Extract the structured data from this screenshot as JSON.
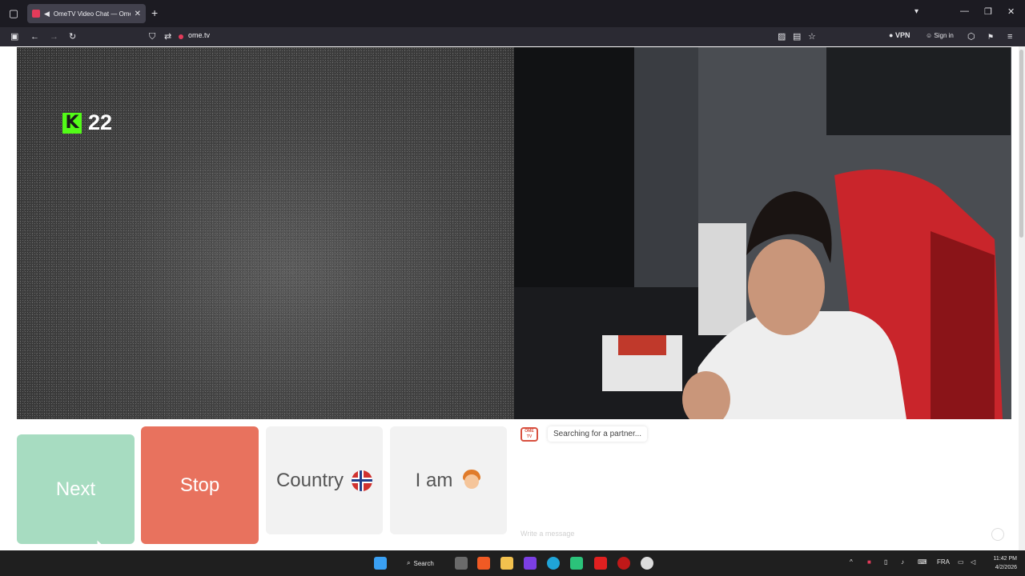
{
  "browser": {
    "tab": {
      "title": "OmeTV Video Chat — Ome",
      "close": "✕"
    },
    "new_tab": "+",
    "url": "ome.tv",
    "vpn_label": "VPN",
    "signin_label": "Sign in"
  },
  "page": {
    "viewer_count": "22",
    "kick_logo": "K",
    "buttons": {
      "next": "Next",
      "stop": "Stop",
      "country": "Country",
      "i_am": "I am"
    },
    "chat": {
      "logo_text": "OME TV",
      "status_message": "Searching for a partner...",
      "input_placeholder": "Write a message"
    }
  },
  "taskbar": {
    "search_label": "Search",
    "language": "FRA",
    "time": "11:42 PM",
    "date": "4/2/2026"
  },
  "colors": {
    "next": "#a7dcc1",
    "stop": "#e8725e",
    "kick_green": "#53fc18"
  }
}
